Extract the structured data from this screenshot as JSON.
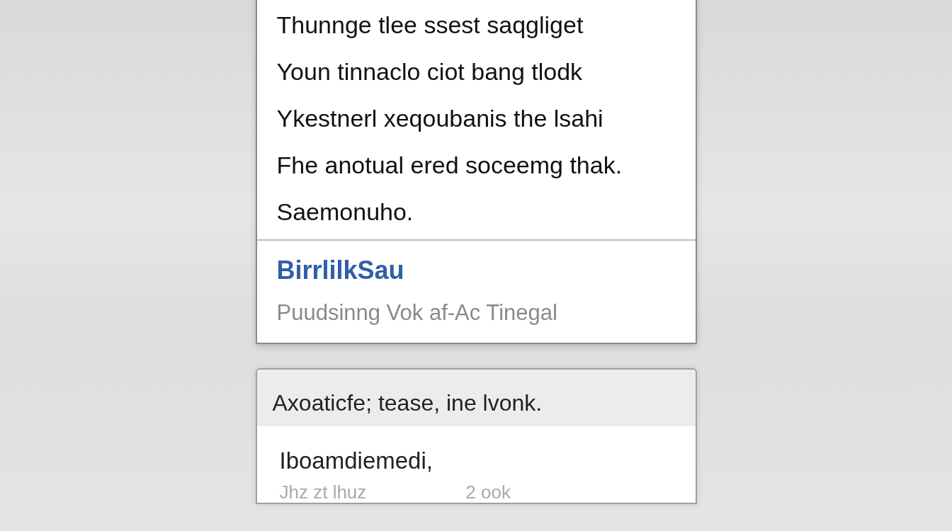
{
  "article_card": {
    "lines": [
      "Thunnge tlee ssest saqgliget",
      "Youn tinnaclo ciot bang tlodk",
      "Ykestnerl xeqoubanis the lsahi",
      "Fhe anotual ered soceemg thak.",
      "Saemonuho."
    ],
    "title": "BirrlilkSau",
    "subtitle": "Puudsinng Vok af-Ac Tinegal"
  },
  "note_card": {
    "header": "Axoaticfe; tease, ine lvonk.",
    "body": "Iboamdiemedi,",
    "footer_left": "Jhz zt lhuz",
    "footer_right": "2 ook"
  }
}
